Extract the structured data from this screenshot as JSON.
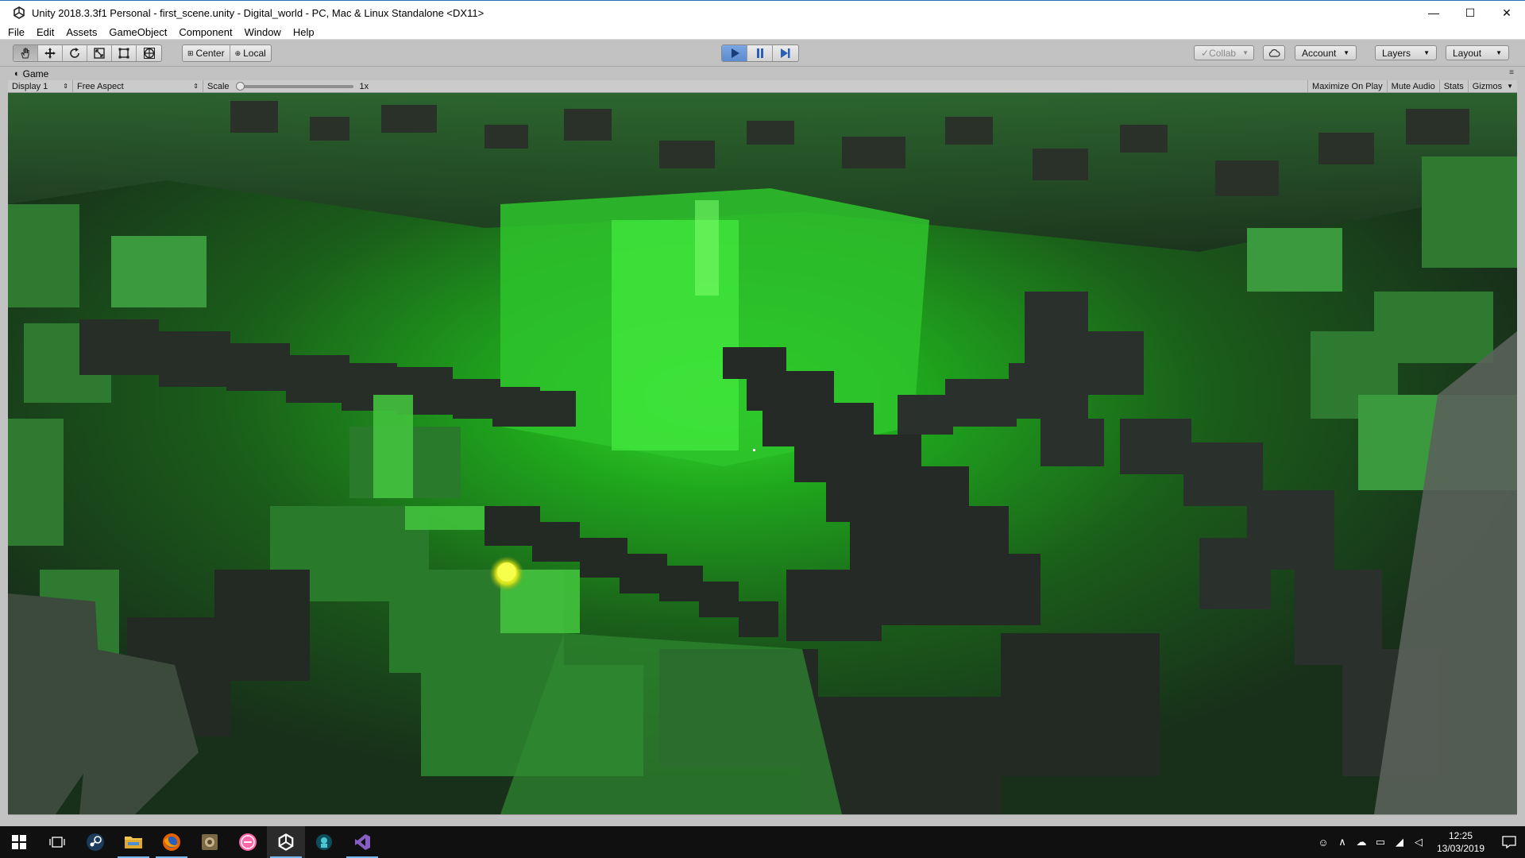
{
  "window": {
    "title": "Unity 2018.3.3f1 Personal - first_scene.unity - Digital_world - PC, Mac & Linux Standalone <DX11>",
    "controls": {
      "minimize": "—",
      "maximize": "☐",
      "close": "✕"
    }
  },
  "menu": [
    "File",
    "Edit",
    "Assets",
    "GameObject",
    "Component",
    "Window",
    "Help"
  ],
  "toolbar": {
    "pivot_label": "Center",
    "space_label": "Local",
    "collab_label": "Collab",
    "account_label": "Account",
    "layers_label": "Layers",
    "layout_label": "Layout"
  },
  "game_panel": {
    "tab_label": "Game",
    "display": "Display 1",
    "aspect": "Free Aspect",
    "scale_label": "Scale",
    "scale_value": "1x",
    "scale_fraction": 0.0,
    "maximize_on_play": "Maximize On Play",
    "mute_audio": "Mute Audio",
    "stats": "Stats",
    "gizmos": "Gizmos"
  },
  "taskbar": {
    "apps": [
      "windows-start",
      "task-view",
      "steam",
      "file-explorer",
      "firefox",
      "app-generic",
      "osu",
      "unity",
      "app-dark",
      "visual-studio"
    ],
    "time": "12:25",
    "date": "13/03/2019"
  },
  "colors": {
    "accent_play": "#5b8bd0",
    "scene_bright_green": "#3ef03a",
    "scene_dark_block": "#262b26"
  }
}
